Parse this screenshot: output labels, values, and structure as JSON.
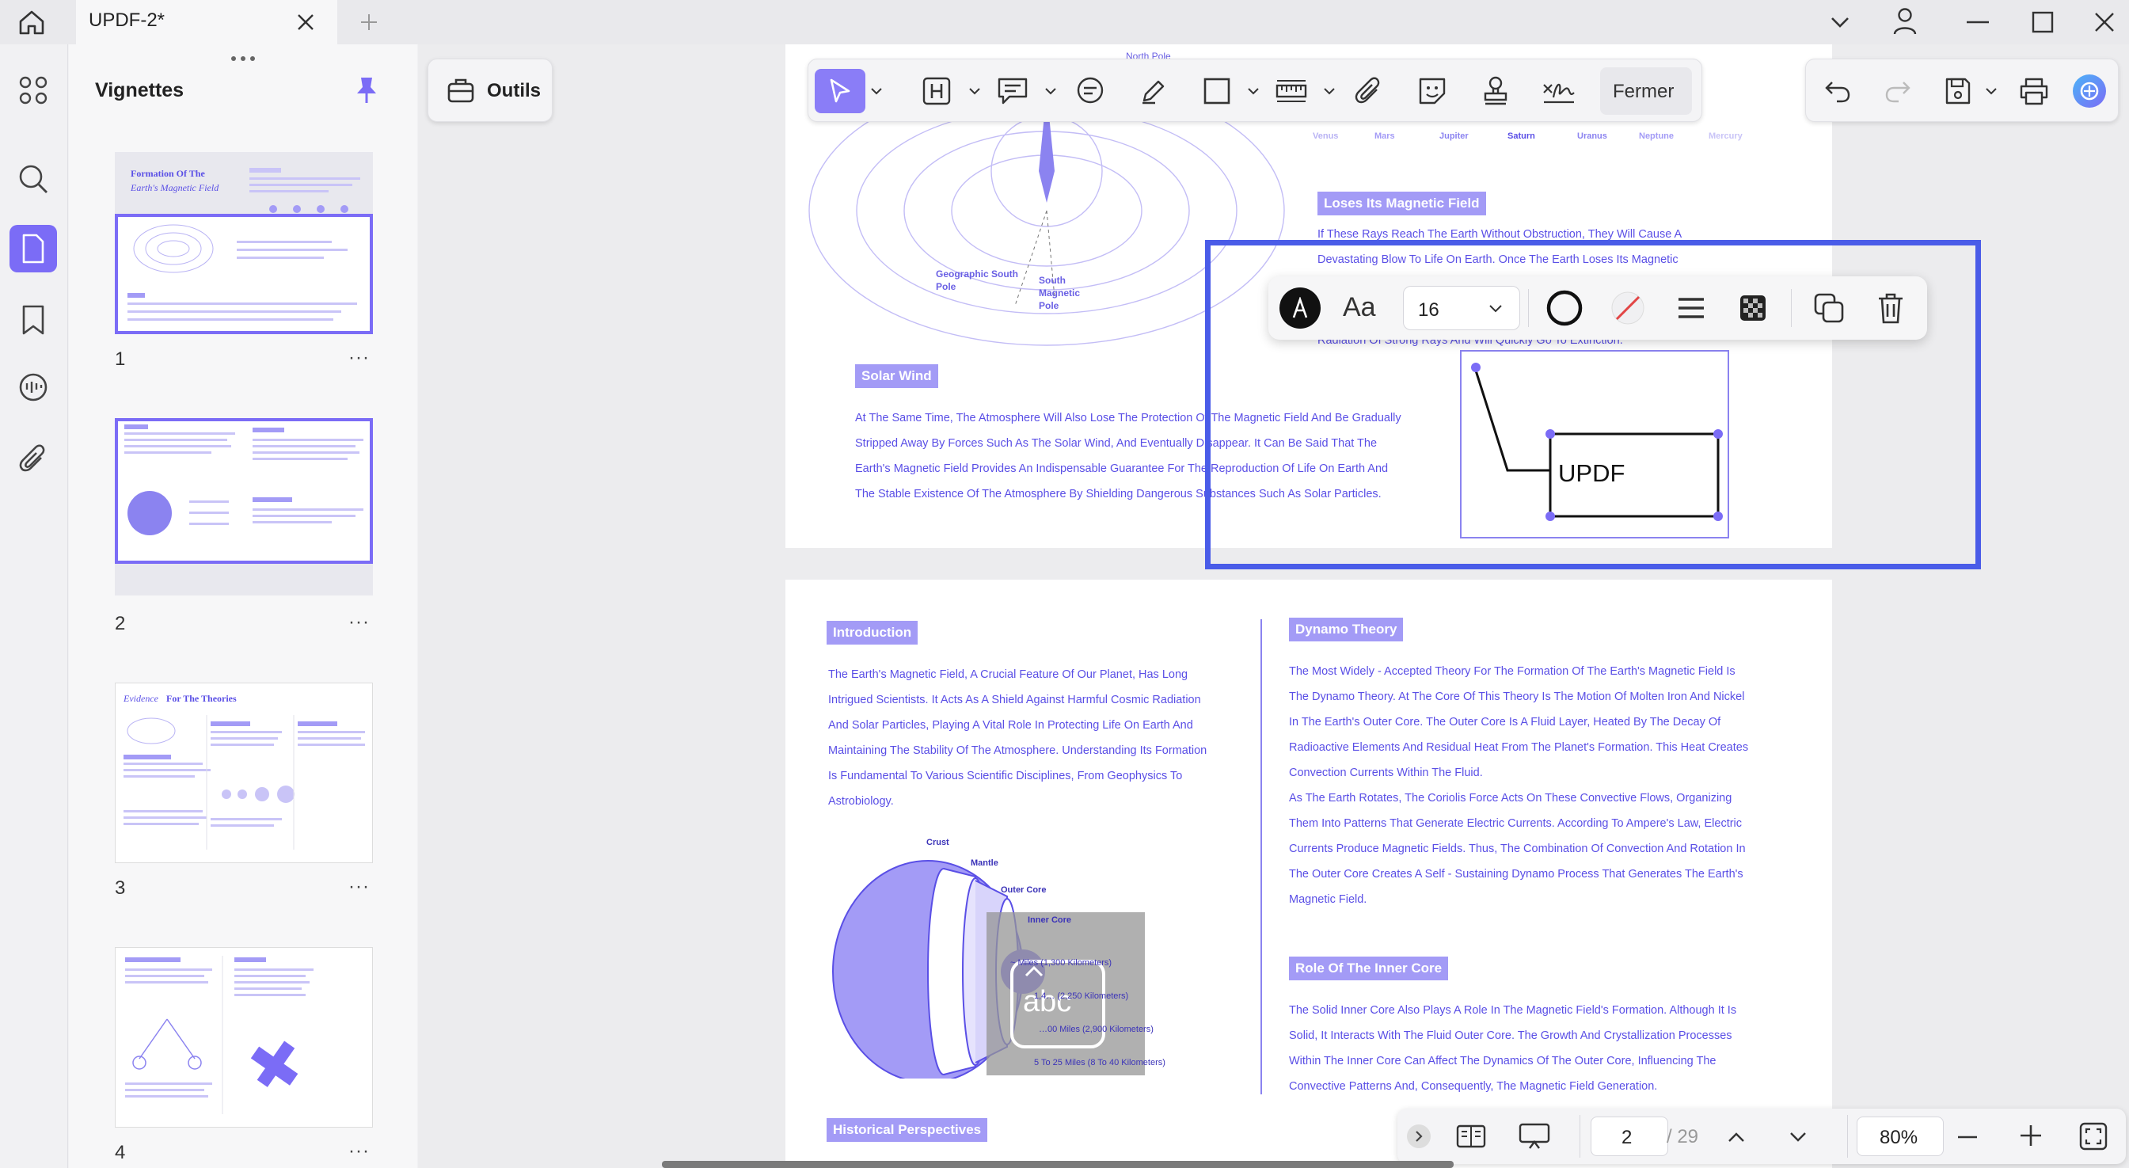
{
  "window": {
    "tab_title": "UPDF-2*"
  },
  "sidebar": {
    "title": "Vignettes",
    "pages": [
      {
        "number": "1",
        "more": "···"
      },
      {
        "number": "2",
        "more": "···"
      },
      {
        "number": "3",
        "more": "···"
      },
      {
        "number": "4",
        "more": "···"
      }
    ]
  },
  "tools": {
    "outils_label": "Outils",
    "fermer_label": "Fermer"
  },
  "float_toolbar": {
    "font_size": "16",
    "font_icon_label": "Aa"
  },
  "page_top": {
    "north_pole": "North Pole",
    "geo_south_pole": "Geographic South Pole",
    "south_magnetic_pole": "South Magnetic Pole",
    "planets": [
      "Venus",
      "Mars",
      "Jupiter",
      "Saturn",
      "Uranus",
      "Neptune",
      "Mercury"
    ],
    "loses_heading": "Loses Its Magnetic Field",
    "loses_text": [
      "If These Rays Reach The Earth Without Obstruction, They Will Cause A",
      "Devastating Blow To Life On Earth. Once The Earth Loses Its Magnetic",
      "Radiation Of Strong Rays And Will Quickly Go To Extinction."
    ],
    "solar_heading": "Solar Wind",
    "solar_text": [
      "At The Same Time, The Atmosphere Will Also Lose The Protection Of The Magnetic Field And Be Gradually",
      "Stripped Away By Forces Such As The Solar Wind, And Eventually Disappear. It Can Be Said That The",
      "Earth's Magnetic Field Provides An Indispensable Guarantee For The Reproduction Of Life On Earth And",
      "The Stable Existence Of The Atmosphere By Shielding Dangerous Substances Such As Solar Particles."
    ],
    "callout_text": "UPDF"
  },
  "page_main": {
    "intro_heading": "Introduction",
    "intro_text": [
      "The Earth's Magnetic Field, A Crucial Feature Of Our Planet, Has Long",
      "Intrigued Scientists. It Acts As A Shield Against Harmful Cosmic Radiation",
      "And Solar Particles, Playing A Vital Role In Protecting Life On Earth And",
      "Maintaining The Stability Of The Atmosphere. Understanding Its Formation",
      "Is Fundamental To Various Scientific Disciplines, From Geophysics To",
      "Astrobiology."
    ],
    "diagram": {
      "crust": "Crust",
      "mantle": "Mantle",
      "outer_core": "Outer Core",
      "inner_core": "Inner Core",
      "dims": [
        "~ Miles (1,300 Kilometers)",
        "1,4… (2,250 Kilometers)",
        "…00 Miles (2,900 Kilometers)",
        "5 To 25 Miles (8 To 40 Kilometers)"
      ],
      "stamp_text": "abc"
    },
    "dynamo_heading": "Dynamo Theory",
    "dynamo_text": [
      "The Most Widely - Accepted Theory For The Formation Of The Earth's Magnetic Field Is",
      "The Dynamo Theory. At The Core Of This Theory Is The Motion Of Molten Iron And Nickel",
      "In The Earth's Outer Core. The Outer Core Is A Fluid Layer, Heated By The Decay Of",
      "Radioactive Elements And Residual Heat From The Planet's Formation. This Heat Creates",
      "Convection Currents Within The Fluid.",
      "As The Earth Rotates, The Coriolis Force Acts On These Convective Flows, Organizing",
      "Them Into Patterns That Generate Electric Currents. According To Ampere's Law, Electric",
      "Currents Produce Magnetic Fields. Thus, The Combination Of Convection And Rotation In",
      "The Outer Core Creates A Self - Sustaining Dynamo Process That Generates The Earth's",
      "Magnetic Field."
    ],
    "inner_heading": "Role Of The Inner Core",
    "inner_text": [
      "The Solid Inner Core Also Plays A Role In The Magnetic Field's Formation. Although It Is",
      "Solid, It Interacts With The Fluid Outer Core. The Growth And Crystallization Processes",
      "Within The Inner Core Can Affect The Dynamics Of The Outer Core, Influencing The",
      "Convective Patterns And, Consequently, The Magnetic Field Generation."
    ],
    "historical_heading": "Historical Perspectives"
  },
  "thumbnails": {
    "t1_title_line1": "Formation Of The",
    "t1_title_line2": "Earth's Magnetic Field",
    "t3_title_a": "Evidence",
    "t3_title_b": "For The Theories"
  },
  "navigation": {
    "current_page": "2",
    "total_pages": "/ 29",
    "zoom": "80%"
  },
  "colors": {
    "accent": "#7b6cf6",
    "selection": "#4a5ce8",
    "doc_text": "#5a4fe6"
  }
}
